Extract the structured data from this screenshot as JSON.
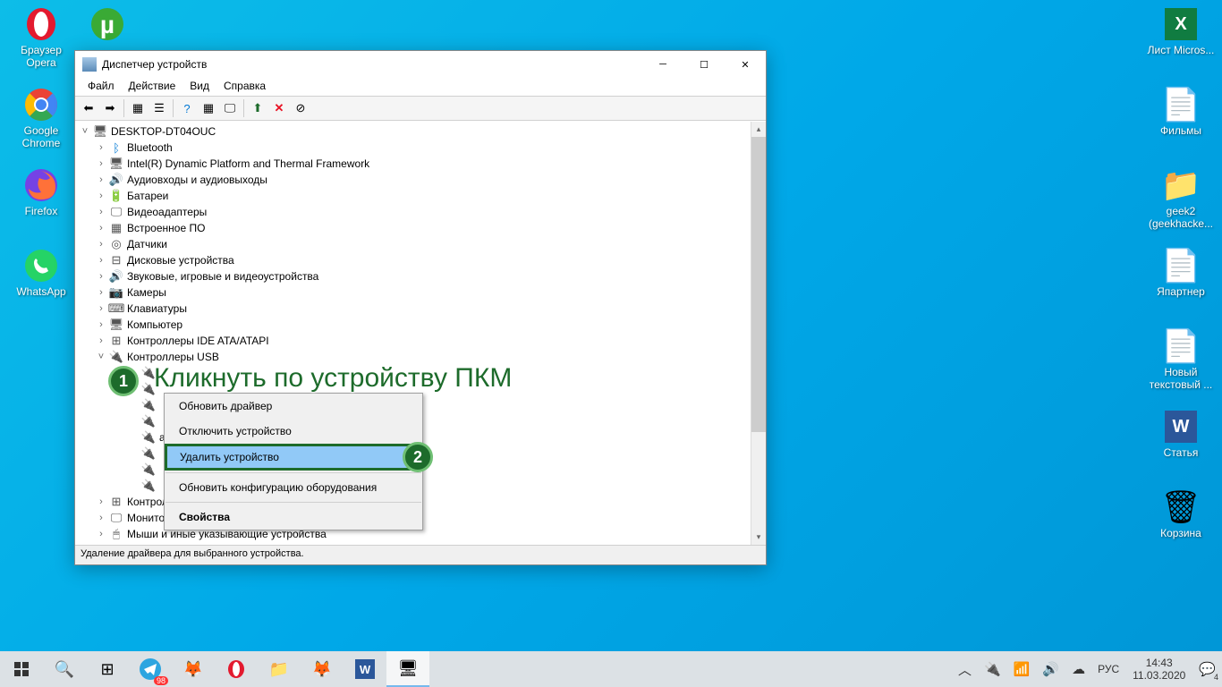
{
  "desktop_left": [
    {
      "label": "Браузер Opera",
      "color": "#e31a2f",
      "glyph": "O"
    },
    {
      "label": "Google Chrome",
      "color": "#ffc107",
      "glyph": "◉"
    },
    {
      "label": "Firefox",
      "color": "#ff7139",
      "glyph": "🦊"
    },
    {
      "label": "WhatsApp",
      "color": "#25d366",
      "glyph": "✆"
    }
  ],
  "desktop_left2": {
    "label": "",
    "glyph": "µ"
  },
  "desktop_right": [
    {
      "label": "Лист Micros...",
      "glyph": "X",
      "color": "#107c41"
    },
    {
      "label": "Фильмы",
      "glyph": "📄",
      "color": "#fff"
    },
    {
      "label": "geek2 (geekhacke...",
      "glyph": "📁",
      "color": "#ffd35a"
    },
    {
      "label": "Япартнер",
      "glyph": "📄",
      "color": "#fff"
    },
    {
      "label": "Новый текстовый ...",
      "glyph": "📄",
      "color": "#fff"
    },
    {
      "label": "Статья",
      "glyph": "W",
      "color": "#2b579a"
    },
    {
      "label": "Корзина",
      "glyph": "🗑",
      "color": "#fff"
    }
  ],
  "window": {
    "title": "Диспетчер устройств",
    "menu": [
      "Файл",
      "Действие",
      "Вид",
      "Справка"
    ],
    "status": "Удаление драйвера для выбранного устройства."
  },
  "tree": {
    "root": "DESKTOP-DT04OUC",
    "items": [
      {
        "label": "Bluetooth",
        "ico": "ᛒ",
        "c": "#0078d4"
      },
      {
        "label": "Intel(R) Dynamic Platform and Thermal Framework",
        "ico": "🖥",
        "c": "#555"
      },
      {
        "label": "Аудиовходы и аудиовыходы",
        "ico": "🔊",
        "c": "#555"
      },
      {
        "label": "Батареи",
        "ico": "🔋",
        "c": "#555"
      },
      {
        "label": "Видеоадаптеры",
        "ico": "🖵",
        "c": "#555"
      },
      {
        "label": "Встроенное ПО",
        "ico": "▦",
        "c": "#555"
      },
      {
        "label": "Датчики",
        "ico": "◎",
        "c": "#555"
      },
      {
        "label": "Дисковые устройства",
        "ico": "⊟",
        "c": "#555"
      },
      {
        "label": "Звуковые, игровые и видеоустройства",
        "ico": "🔊",
        "c": "#555"
      },
      {
        "label": "Камеры",
        "ico": "📷",
        "c": "#555"
      },
      {
        "label": "Клавиатуры",
        "ico": "⌨",
        "c": "#555"
      },
      {
        "label": "Компьютер",
        "ico": "🖥",
        "c": "#555"
      },
      {
        "label": "Контроллеры IDE ATA/ATAPI",
        "ico": "⊞",
        "c": "#555"
      }
    ],
    "usb_label": "Контроллеры USB",
    "usb_partial": "айкрософт)",
    "storage": "Контроллеры запоминающих устройств",
    "monitors": "Мониторы",
    "mice": "Мыши и иные указывающие устройства"
  },
  "context": {
    "update": "Обновить драйвер",
    "disable": "Отключить устройство",
    "remove": "Удалить устройство",
    "scan": "Обновить конфигурацию оборудования",
    "props": "Свойства"
  },
  "annotation": {
    "badge1": "1",
    "badge2": "2",
    "text1": "Кликнуть по устройству ПКМ"
  },
  "tray": {
    "lang": "РУС",
    "time": "14:43",
    "date": "11.03.2020",
    "count": "4"
  }
}
